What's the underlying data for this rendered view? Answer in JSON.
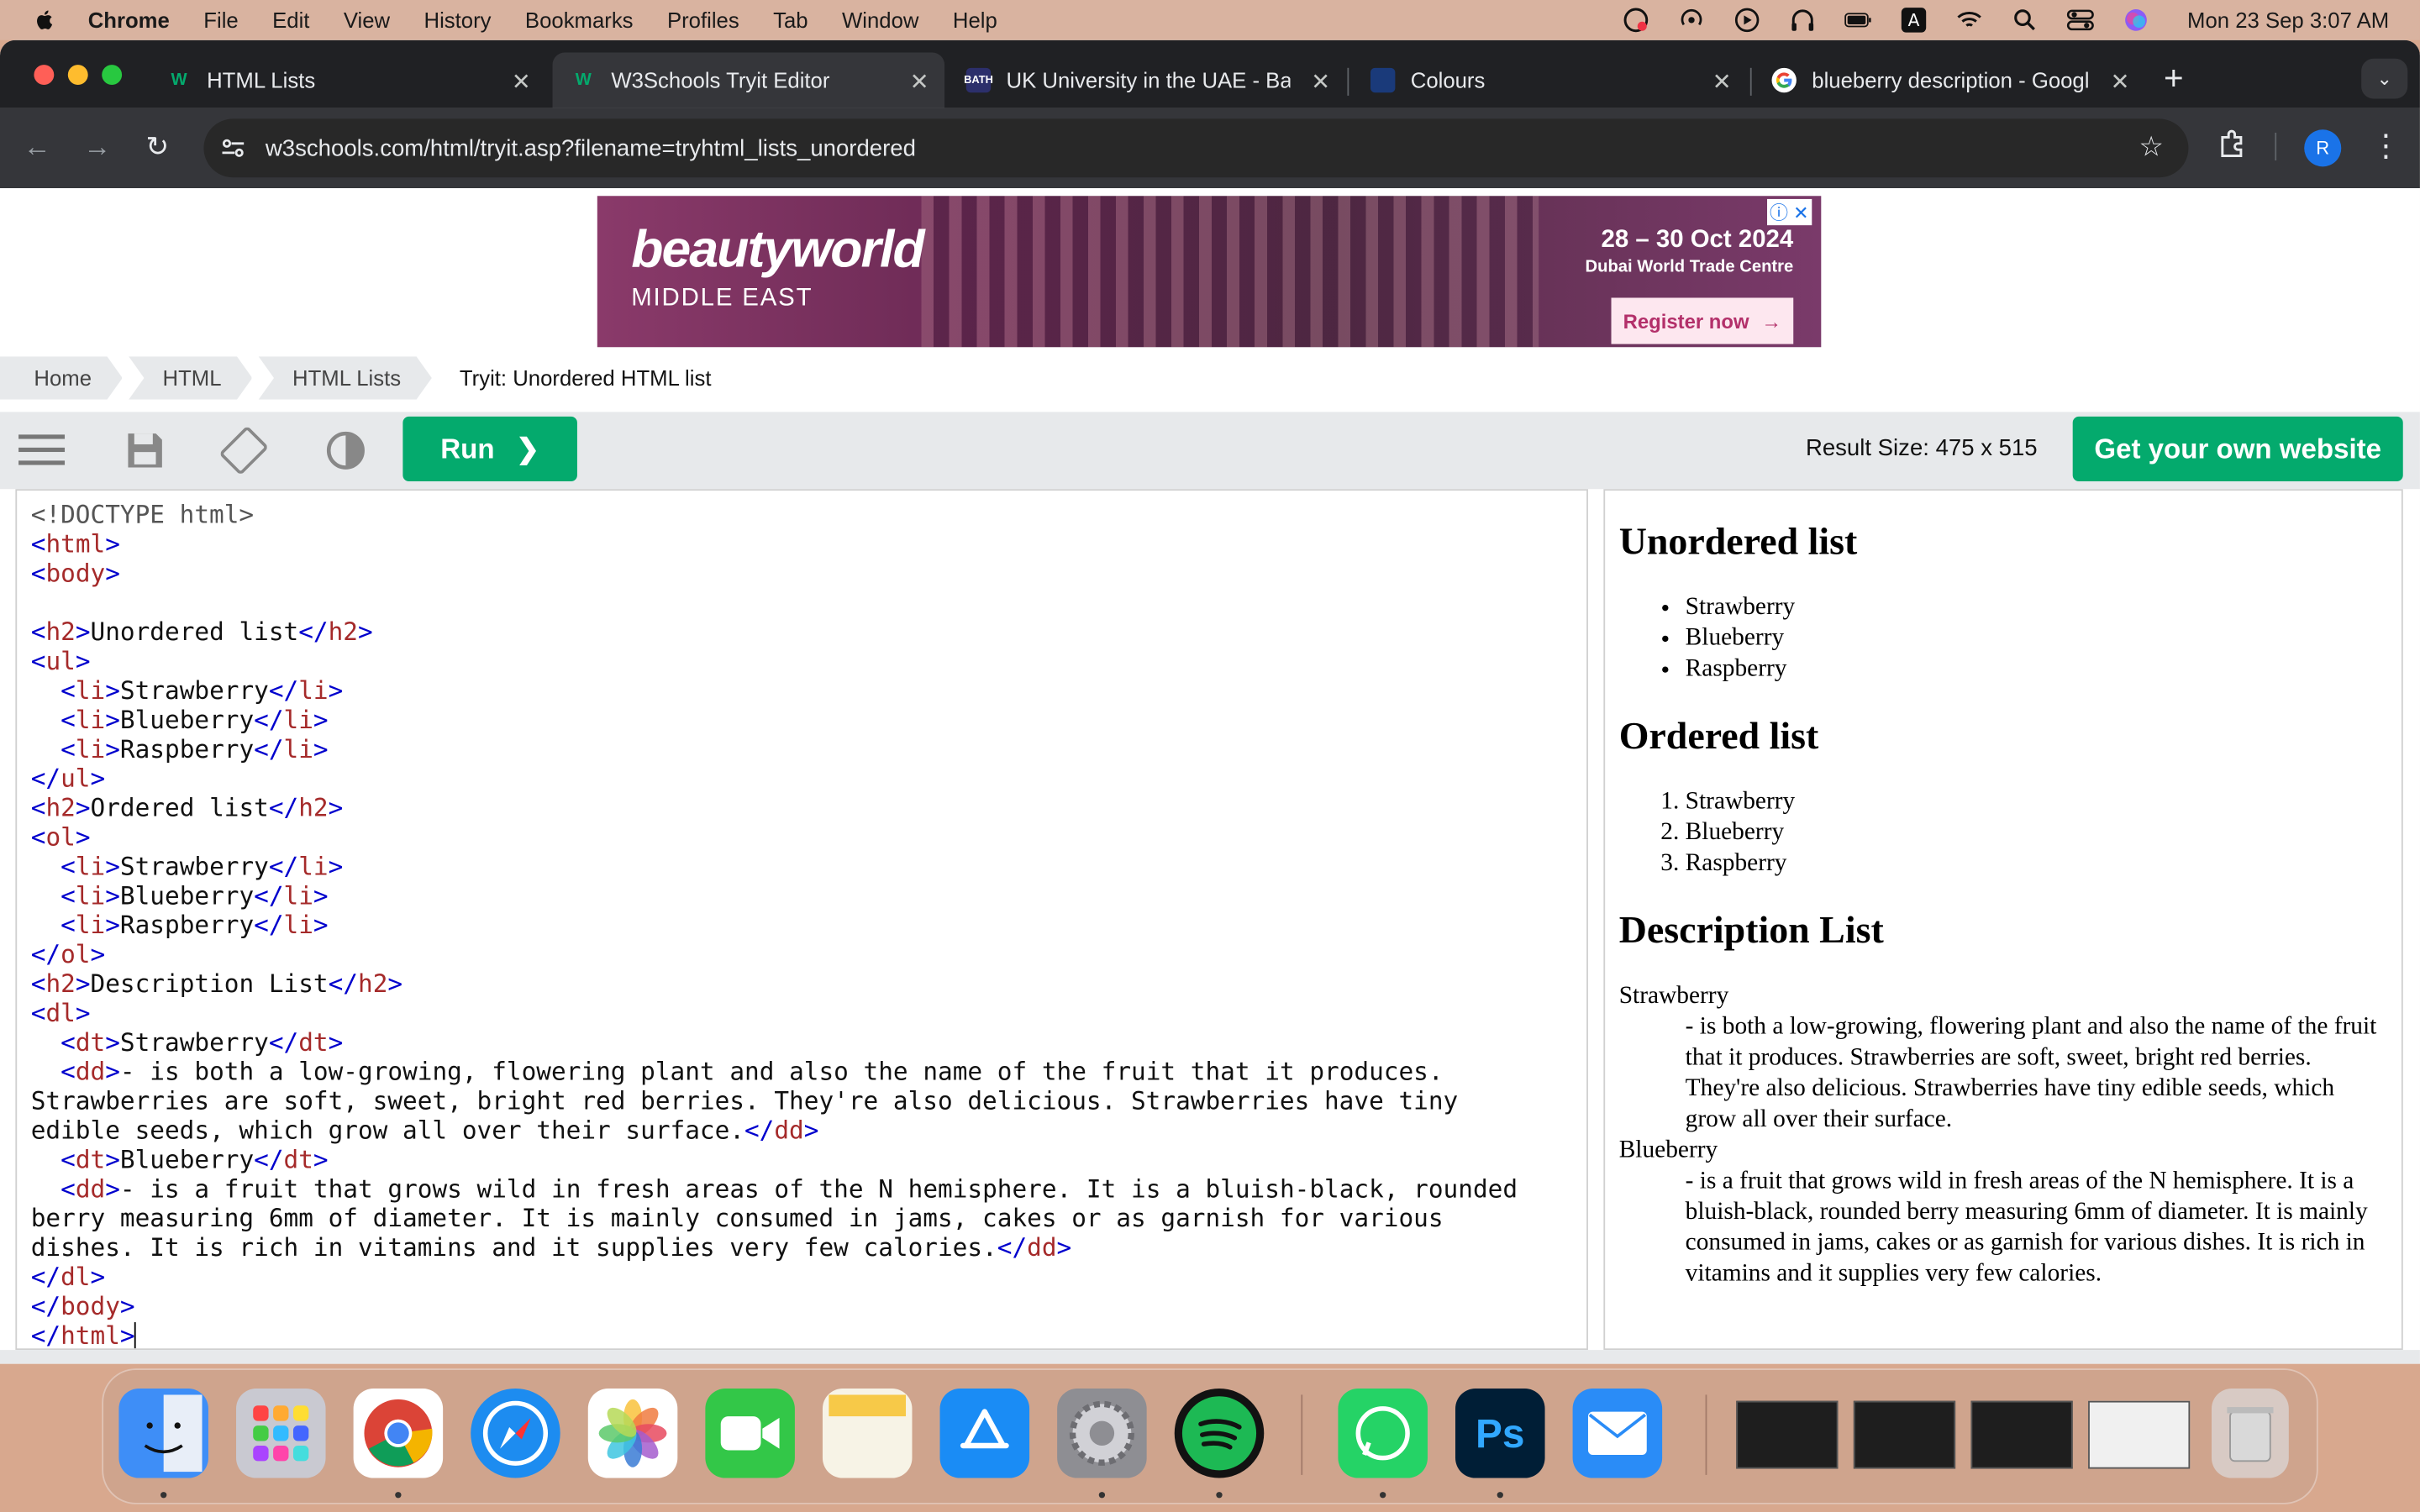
{
  "menubar": {
    "app": "Chrome",
    "items": [
      "File",
      "Edit",
      "View",
      "History",
      "Bookmarks",
      "Profiles",
      "Tab",
      "Window",
      "Help"
    ],
    "clock": "Mon 23 Sep  3:07 AM"
  },
  "tabs": [
    {
      "title": "HTML Lists",
      "active": false
    },
    {
      "title": "W3Schools Tryit Editor",
      "active": true
    },
    {
      "title": "UK University in the UAE - Ba",
      "active": false
    },
    {
      "title": "Colours",
      "active": false
    },
    {
      "title": "blueberry description - Googl",
      "active": false
    }
  ],
  "address": {
    "url": "w3schools.com/html/tryit.asp?filename=tryhtml_lists_unordered"
  },
  "profile_initial": "R",
  "ad": {
    "brand": "beautyworld",
    "sub": "MIDDLE EAST",
    "date": "28 – 30 Oct 2024",
    "venue": "Dubai World Trade Centre",
    "cta": "Register now"
  },
  "breadcrumb": [
    "Home",
    "HTML",
    "HTML Lists",
    "Tryit: Unordered HTML list"
  ],
  "editor": {
    "run_label": "Run",
    "result_size": "Result Size: 475 x 515",
    "own_site_label": "Get your own website"
  },
  "code_lines": [
    "<!DOCTYPE html>",
    "<html>",
    "<body>",
    "",
    "<h2>Unordered list</h2>",
    "<ul>",
    "  <li>Strawberry</li>",
    "  <li>Blueberry</li>",
    "  <li>Raspberry</li>",
    "</ul>",
    "<h2>Ordered list</h2>",
    "<ol>",
    "  <li>Strawberry</li>",
    "  <li>Blueberry</li>",
    "  <li>Raspberry</li>",
    "</ol>",
    "<h2>Description List</h2>",
    "<dl>",
    "  <dt>Strawberry</dt>",
    "  <dd>- is both a low-growing, flowering plant and also the name of the fruit that it produces.",
    "Strawberries are soft, sweet, bright red berries. They're also delicious. Strawberries have tiny",
    "edible seeds, which grow all over their surface.</dd>",
    "  <dt>Blueberry</dt>",
    "  <dd>- is a fruit that grows wild in fresh areas of the N hemisphere. It is a bluish-black, rounded",
    "berry measuring 6mm of diameter. It is mainly consumed in jams, cakes or as garnish for various",
    "dishes. It is rich in vitamins and it supplies very few calories.</dd>",
    "</dl>",
    "</body>",
    "</html>"
  ],
  "result": {
    "h_unordered": "Unordered list",
    "ul": [
      "Strawberry",
      "Blueberry",
      "Raspberry"
    ],
    "h_ordered": "Ordered list",
    "ol": [
      "Strawberry",
      "Blueberry",
      "Raspberry"
    ],
    "h_desc": "Description List",
    "dl": [
      {
        "dt": "Strawberry",
        "dd": "- is both a low-growing, flowering plant and also the name of the fruit that it produces. Strawberries are soft, sweet, bright red berries. They're also delicious. Strawberries have tiny edible seeds, which grow all over their surface."
      },
      {
        "dt": "Blueberry",
        "dd": "- is a fruit that grows wild in fresh areas of the N hemisphere. It is a bluish-black, rounded berry measuring 6mm of diameter. It is mainly consumed in jams, cakes or as garnish for various dishes. It is rich in vitamins and it supplies very few calories."
      }
    ]
  },
  "dock": {
    "apps": [
      {
        "name": "finder-icon",
        "color": "#3e8ef7"
      },
      {
        "name": "launchpad-icon",
        "color": "#c9c9d1"
      },
      {
        "name": "chrome-icon",
        "color": "#ffffff"
      },
      {
        "name": "safari-icon",
        "color": "#1d8cf0"
      },
      {
        "name": "photos-icon",
        "color": "#ffffff"
      },
      {
        "name": "facetime-icon",
        "color": "#33c748"
      },
      {
        "name": "notes-icon",
        "color": "#f7f3e6"
      },
      {
        "name": "app-store-icon",
        "color": "#1a8cf5"
      },
      {
        "name": "system-settings-icon",
        "color": "#8e8e93"
      },
      {
        "name": "spotify-icon",
        "color": "#121212"
      },
      {
        "name": "whatsapp-icon",
        "color": "#25d366"
      },
      {
        "name": "photoshop-icon",
        "color": "#001e36"
      },
      {
        "name": "mail-icon",
        "color": "#2a8cf7"
      }
    ],
    "ps_label": "Ps"
  }
}
